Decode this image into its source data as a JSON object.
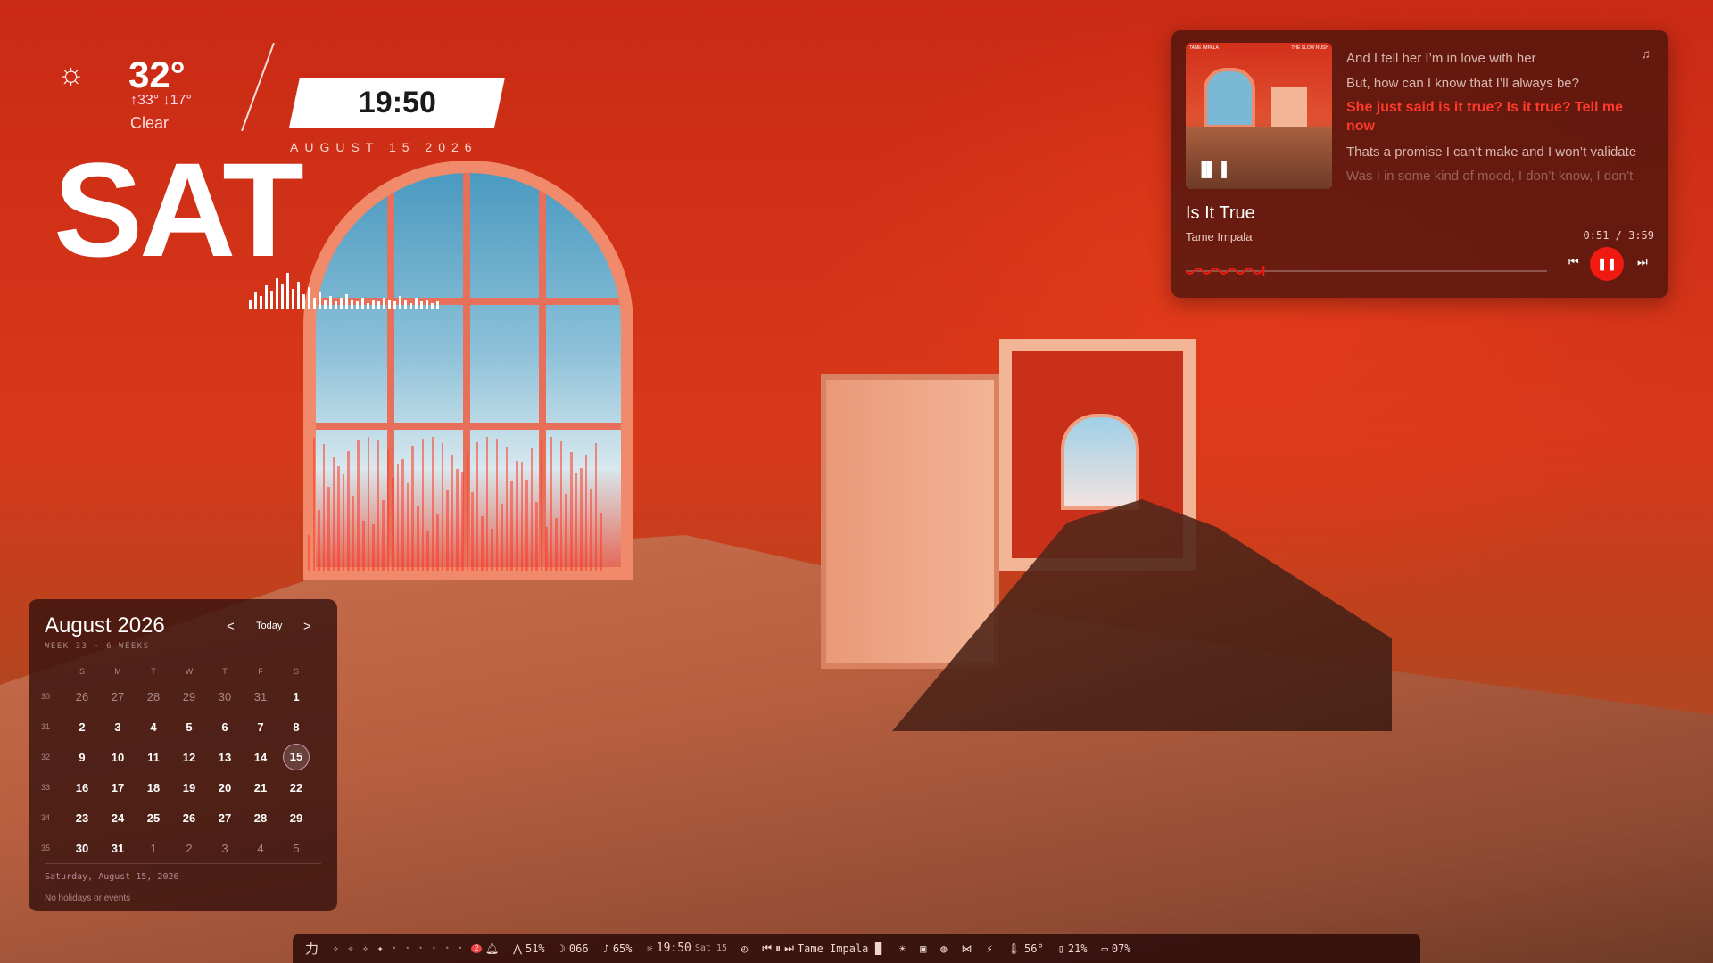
{
  "weather": {
    "icon": "sun-icon",
    "temperature": "32°",
    "high": "↑33°",
    "low": "↓17°",
    "condition": "Clear"
  },
  "clock": {
    "time": "19:50",
    "date": "AUGUST 15 2026",
    "day": "SAT"
  },
  "player": {
    "lyrics": [
      "And I tell her I’m in love with her",
      "But, how can I know that I’ll always be?",
      "She just said is it true? Is it true? Tell me now",
      "Thats a promise I can’t make and I won’t validate",
      "Was I in some kind of mood, I don’t know, I don’t"
    ],
    "active_lyric_index": 2,
    "title": "Is It True",
    "artist": "Tame Impala",
    "elapsed_time": "0:51 / 3:59",
    "progress": 0.213,
    "album_text_left": "TAME IMPALA",
    "album_text_right": "THE SLOW RUSH",
    "accent_color": "#f01a10"
  },
  "calendar": {
    "month_title": "August 2026",
    "week_info": "WEEK 33 · 6 WEEKS",
    "prev_label": "<",
    "today_label": "Today",
    "next_label": ">",
    "weekday_headers": [
      "S",
      "M",
      "T",
      "W",
      "T",
      "F",
      "S"
    ],
    "weeks": [
      {
        "num": "30",
        "days": [
          "26",
          "27",
          "28",
          "29",
          "30",
          "31",
          "1"
        ],
        "outside": [
          true,
          true,
          true,
          true,
          true,
          true,
          false
        ]
      },
      {
        "num": "31",
        "days": [
          "2",
          "3",
          "4",
          "5",
          "6",
          "7",
          "8"
        ],
        "outside": [
          false,
          false,
          false,
          false,
          false,
          false,
          false
        ]
      },
      {
        "num": "32",
        "days": [
          "9",
          "10",
          "11",
          "12",
          "13",
          "14",
          "15"
        ],
        "outside": [
          false,
          false,
          false,
          false,
          false,
          false,
          false
        ]
      },
      {
        "num": "33",
        "days": [
          "16",
          "17",
          "18",
          "19",
          "20",
          "21",
          "22"
        ],
        "outside": [
          false,
          false,
          false,
          false,
          false,
          false,
          false
        ]
      },
      {
        "num": "34",
        "days": [
          "23",
          "24",
          "25",
          "26",
          "27",
          "28",
          "29"
        ],
        "outside": [
          false,
          false,
          false,
          false,
          false,
          false,
          false
        ]
      },
      {
        "num": "35",
        "days": [
          "30",
          "31",
          "1",
          "2",
          "3",
          "4",
          "5"
        ],
        "outside": [
          false,
          false,
          true,
          true,
          true,
          true,
          true
        ]
      }
    ],
    "today": "15",
    "selected_date": "Saturday, August 15, 2026",
    "events_text": "No holidays or events"
  },
  "statusbar": {
    "logo": "力",
    "notification_count": "2",
    "cpu": "51%",
    "moon_value": "066",
    "volume": "65%",
    "time": "19:50",
    "date": "Sat 15",
    "media_artist": "Tame Impala",
    "temp": "56°",
    "brightness": "21%",
    "battery": "07%"
  }
}
